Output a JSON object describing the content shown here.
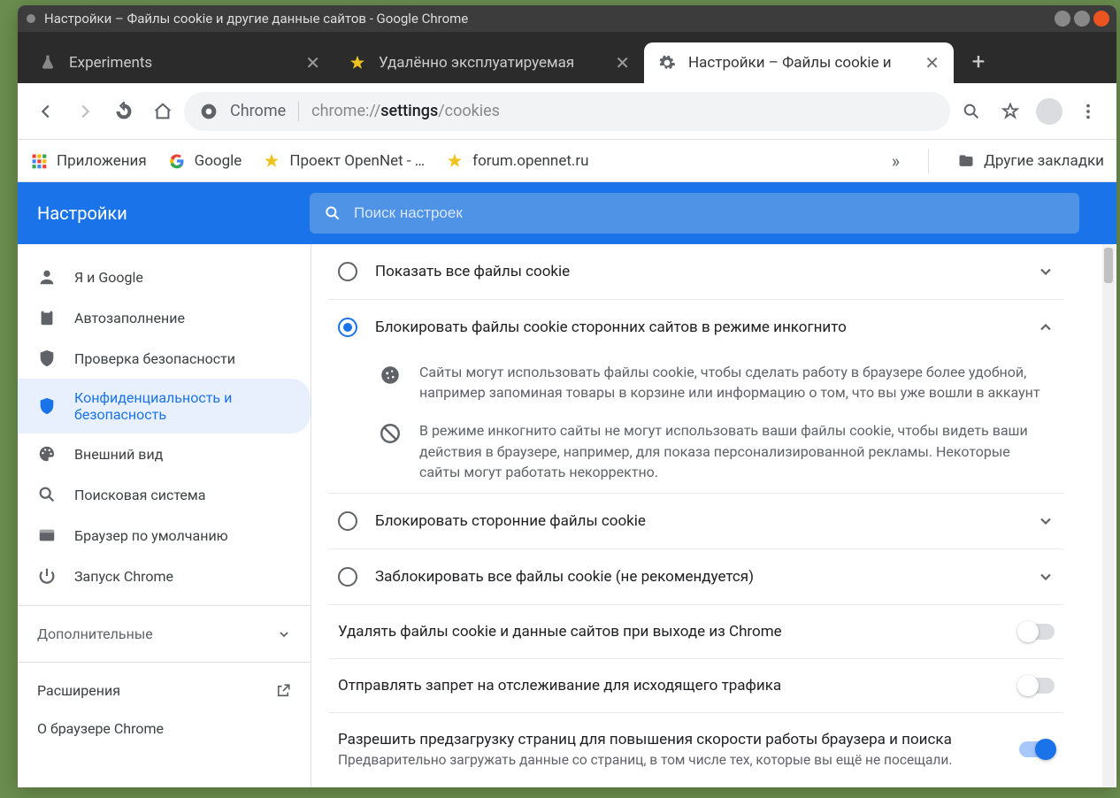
{
  "window": {
    "title": "Настройки – Файлы cookie и другие данные сайтов - Google Chrome"
  },
  "tabs": [
    {
      "label": "Experiments"
    },
    {
      "label": "Удалённо эксплуатируемая"
    },
    {
      "label": "Настройки – Файлы cookie и"
    }
  ],
  "omnibox": {
    "prefix": "Chrome",
    "url_pre": "chrome://",
    "url_bold": "settings",
    "url_post": "/cookies"
  },
  "bookmarks": {
    "apps": "Приложения",
    "google": "Google",
    "opennet": "Проект OpenNet - …",
    "forum": "forum.opennet.ru",
    "other": "Другие закладки"
  },
  "settings": {
    "title": "Настройки",
    "search_placeholder": "Поиск настроек"
  },
  "sidebar": {
    "items": [
      {
        "label": "Я и Google"
      },
      {
        "label": "Автозаполнение"
      },
      {
        "label": "Проверка безопасности"
      },
      {
        "label": "Конфиденциальность и безопасность"
      },
      {
        "label": "Внешний вид"
      },
      {
        "label": "Поисковая система"
      },
      {
        "label": "Браузер по умолчанию"
      },
      {
        "label": "Запуск Chrome"
      }
    ],
    "advanced": "Дополнительные",
    "extensions": "Расширения",
    "about": "О браузере Chrome"
  },
  "options": {
    "show_all": "Показать все файлы cookie",
    "block_incognito": "Блокировать файлы cookie сторонних сайтов в режиме инкогнито",
    "expl1": "Сайты могут использовать файлы cookie, чтобы сделать работу в браузере более удобной, например запоминая товары в корзине или информацию о том, что вы уже вошли в аккаунт",
    "expl2": "В режиме инкогнито сайты не могут использовать ваши файлы cookie, чтобы видеть ваши действия в браузере, например, для показа персонализированной рекламы. Некоторые сайты могут работать некорректно.",
    "block_third": "Блокировать сторонние файлы cookie",
    "block_all": "Заблокировать все файлы cookie (не рекомендуется)",
    "clear_on_exit": "Удалять файлы cookie и данные сайтов при выходе из Chrome",
    "dnt": "Отправлять запрет на отслеживание для исходящего трафика",
    "preload_title": "Разрешить предзагрузку страниц для повышения скорости работы браузера и поиска",
    "preload_sub": "Предварительно загружать данные со страниц, в том числе тех, которые вы ещё не посещали."
  }
}
